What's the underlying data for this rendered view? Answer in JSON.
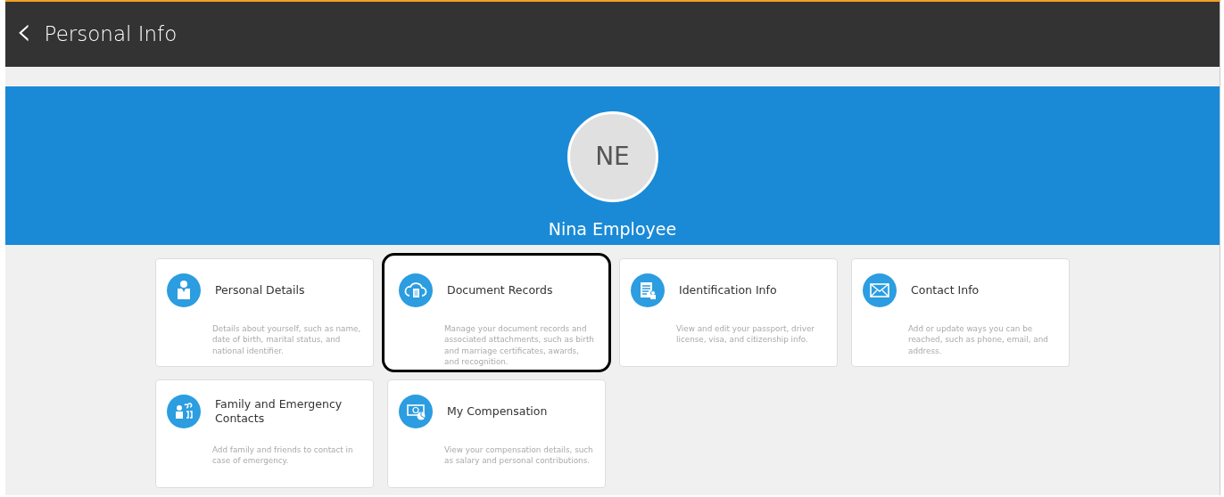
{
  "header": {
    "back": "‹",
    "title": "Personal Info"
  },
  "profile": {
    "initials": "NE",
    "name": "Nina Employee"
  },
  "cards": [
    {
      "kind": "person",
      "title": "Personal Details",
      "description": "Details about yourself, such as name, date of birth, marital status, and national identifier.",
      "highlighted": false
    },
    {
      "kind": "cloud",
      "title": "Document Records",
      "description": "Manage your document records and associated attachments, such as birth and marriage certificates, awards, and recognition.",
      "highlighted": true
    },
    {
      "kind": "document",
      "title": "Identification Info",
      "description": "View and edit your passport, driver license, visa, and citizenship info.",
      "highlighted": false
    },
    {
      "kind": "mail",
      "title": "Contact Info",
      "description": "Add or update ways you can be reached, such as phone, email, and address.",
      "highlighted": false
    },
    {
      "kind": "family",
      "title": "Family and Emergency Contacts",
      "description": "Add family and friends to contact in case of emergency.",
      "highlighted": false
    },
    {
      "kind": "money",
      "title": "My Compensation",
      "description": "View your compensation details, such as salary and personal contributions.",
      "highlighted": false
    }
  ]
}
